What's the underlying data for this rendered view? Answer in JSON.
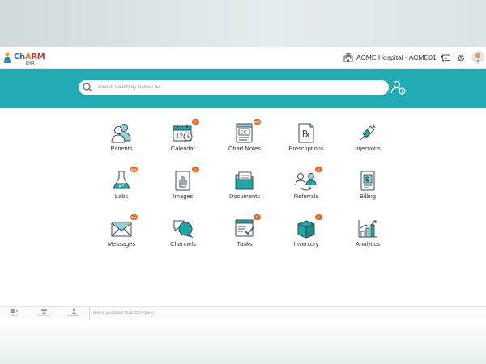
{
  "app": {
    "logo_text_ch": "Ch",
    "logo_text_a": "A",
    "logo_text_rm": "RM",
    "logo_sub": "EHR"
  },
  "header": {
    "hospital": "ACME Hospital - ACME01",
    "icons": [
      "hospital-icon",
      "chat-icon",
      "gear-icon",
      "avatar"
    ]
  },
  "search": {
    "placeholder": "Search Patient by Name / ID"
  },
  "tiles": [
    {
      "label": "Patients",
      "icon": "patients-icon",
      "badge": ""
    },
    {
      "label": "Calendar",
      "icon": "calendar-icon",
      "badge": "1"
    },
    {
      "label": "Chart Notes",
      "icon": "chart-notes-icon",
      "badge": "99+"
    },
    {
      "label": "Prescriptions",
      "icon": "prescription-icon",
      "badge": ""
    },
    {
      "label": "Injections",
      "icon": "syringe-icon",
      "badge": ""
    },
    {
      "label": "Labs",
      "icon": "flask-icon",
      "badge": "99+"
    },
    {
      "label": "Images",
      "icon": "xray-hand-icon",
      "badge": "1"
    },
    {
      "label": "Documents",
      "icon": "folder-icon",
      "badge": ""
    },
    {
      "label": "Referrals",
      "icon": "referral-icon",
      "badge": "1"
    },
    {
      "label": "Billing",
      "icon": "billing-icon",
      "badge": ""
    },
    {
      "label": "Messages",
      "icon": "envelope-icon",
      "badge": "99+"
    },
    {
      "label": "Channels",
      "icon": "chat-bubbles-icon",
      "badge": ""
    },
    {
      "label": "Tasks",
      "icon": "tasks-icon",
      "badge": "11"
    },
    {
      "label": "Inventory",
      "icon": "box-icon",
      "badge": "1"
    },
    {
      "label": "Analytics",
      "icon": "analytics-icon",
      "badge": ""
    }
  ],
  "footer": {
    "items": [
      {
        "label": "Video",
        "icon": "video-icon"
      },
      {
        "label": "Channels",
        "icon": "channels-icon"
      },
      {
        "label": "Contacts",
        "icon": "contacts-icon"
      }
    ],
    "smart_chat_placeholder": "Here is your Smart Chat (Ctrl+Space)"
  },
  "colors": {
    "banner": "#22aab2",
    "accent_teal": "#1fa7a8",
    "badge": "#f26522",
    "icon_dark": "#3b4a54"
  }
}
